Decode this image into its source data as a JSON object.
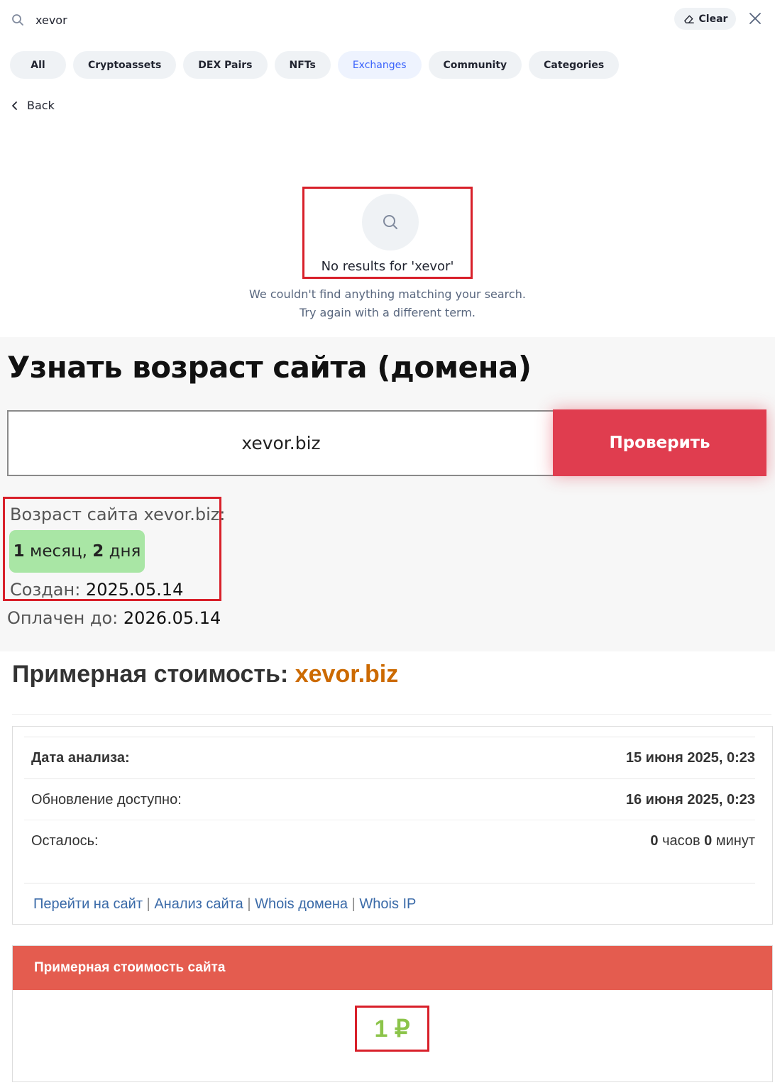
{
  "search": {
    "query": "xevor",
    "clear_label": "Clear",
    "tabs": [
      "All",
      "Cryptoassets",
      "DEX Pairs",
      "NFTs",
      "Exchanges",
      "Community",
      "Categories"
    ],
    "active_tab": "Exchanges",
    "back_label": "Back",
    "no_results_title": "No results for 'xevor'",
    "no_results_line1": "We couldn't find anything matching your search.",
    "no_results_line2": "Try again with a different term.",
    "icons": [
      "search-icon",
      "eraser-icon",
      "close-icon",
      "chevron-left-icon"
    ]
  },
  "age_checker": {
    "title": "Узнать возраст сайта (домена)",
    "domain_value": "xevor.biz",
    "check_button": "Проверить",
    "age_label": "Возраст сайта xevor.biz:",
    "age_value_months_num": "1",
    "age_value_months_word": "месяц,",
    "age_value_days_num": "2",
    "age_value_days_word": "дня",
    "created_label": "Создан:",
    "created_value": "2025.05.14",
    "paid_label": "Оплачен до:",
    "paid_value": "2026.05.14",
    "badge_color": "#a9e6a5",
    "button_color": "#e03d4f"
  },
  "cost": {
    "title_prefix": "Примерная стоимость:",
    "title_domain": "xevor.biz",
    "analysis_date_label": "Дата анализа:",
    "analysis_date_value": "15 июня 2025, 0:23",
    "update_label": "Обновление доступно:",
    "update_value": "16 июня 2025, 0:23",
    "remaining_label": "Осталось:",
    "remaining_hours": "0",
    "remaining_hours_unit": "часов",
    "remaining_minutes": "0",
    "remaining_minutes_unit": "минут",
    "links": [
      "Перейти на сайт",
      "Анализ сайта",
      "Whois домена",
      "Whois IP"
    ],
    "link_separator": "|",
    "price_header": "Примерная стоимость сайта",
    "price_value": "1 ₽",
    "accent_color": "#cc6a00",
    "header_color": "#e45c4f",
    "price_color": "#8cc44a"
  }
}
